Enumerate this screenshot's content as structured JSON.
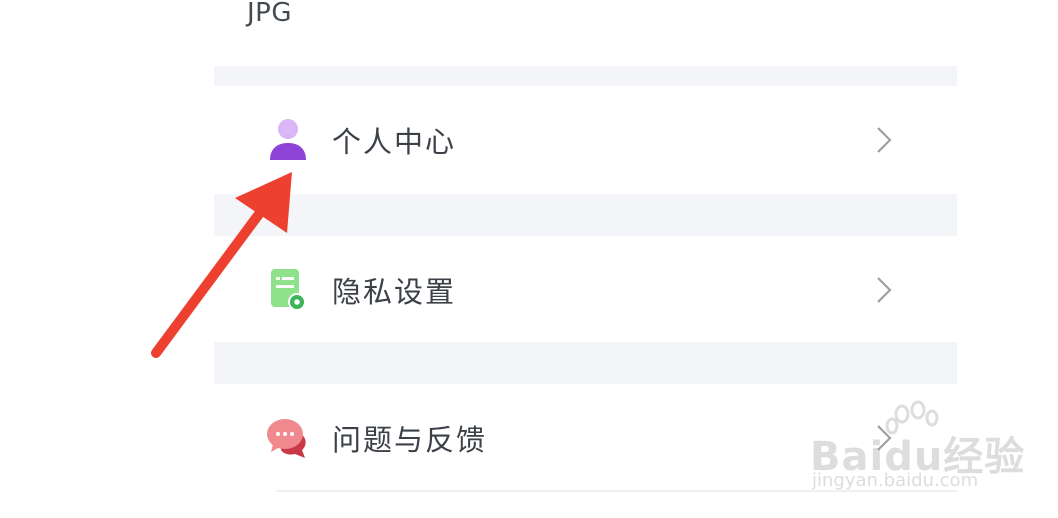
{
  "header": {
    "format_label": "JPG"
  },
  "menu": {
    "items": [
      {
        "label": "个人中心",
        "icon": "person-icon"
      },
      {
        "label": "隐私设置",
        "icon": "privacy-settings-icon"
      },
      {
        "label": "问题与反馈",
        "icon": "feedback-chat-icon"
      }
    ]
  },
  "watermark": {
    "brand": "Baidu经验",
    "url": "jingyan.baidu.com"
  },
  "colors": {
    "background": "#ffffff",
    "spacer": "#f4f5f8",
    "text": "#3c4148",
    "chevron": "#9aa0a6",
    "annotation_arrow": "#ee4030",
    "person_icon": "#8e44d8",
    "privacy_icon": "#7ed87c",
    "feedback_icon": "#e8676d"
  }
}
